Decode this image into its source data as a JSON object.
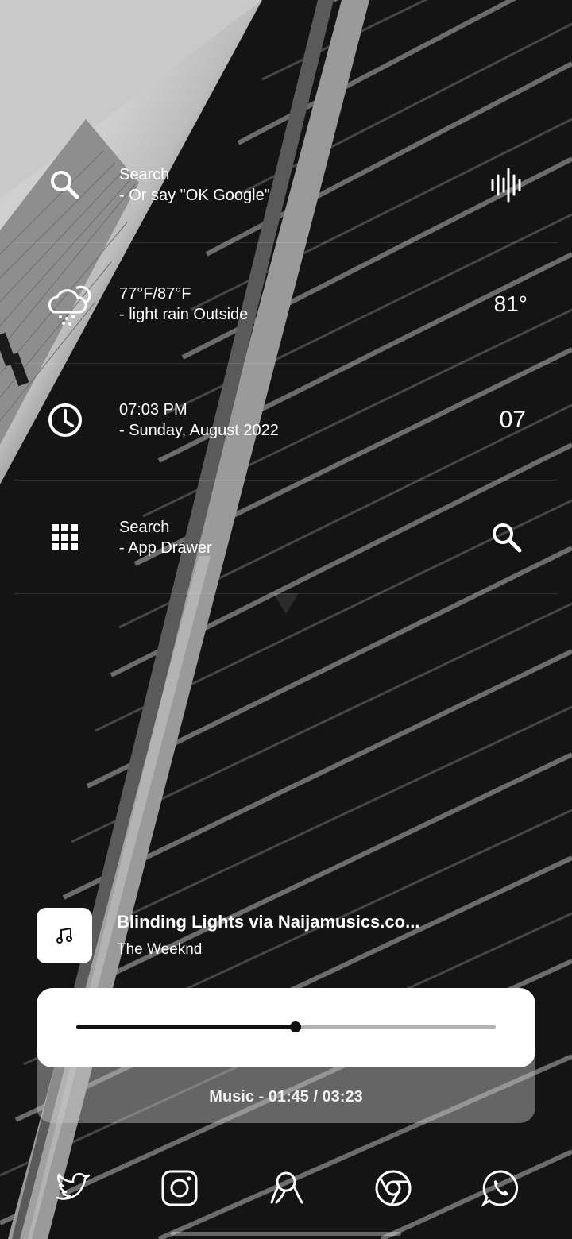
{
  "widgets": {
    "search": {
      "line1": "Search",
      "line2": "- Or say \"OK Google\""
    },
    "weather": {
      "line1": "77°F/87°F",
      "line2": "- light rain Outside",
      "temp": "81°"
    },
    "clock": {
      "line1": "07:03 PM",
      "line2": "- Sunday, August 2022",
      "right": "07"
    },
    "apps": {
      "line1": "Search",
      "line2": "- App Drawer"
    }
  },
  "music": {
    "title": "Blinding Lights via Naijamusics.co...",
    "artist": "The Weeknd",
    "caption": "Music - 01:45 / 03:23",
    "progress": 0.523
  },
  "dock": {
    "apps": [
      "twitter-icon",
      "instagram-icon",
      "beeper-icon",
      "chrome-icon",
      "whatsapp-icon"
    ]
  },
  "colors": {
    "text": "#ffffff",
    "card": "#ffffff",
    "track": "#b3b3b3",
    "accent": "#111111"
  }
}
